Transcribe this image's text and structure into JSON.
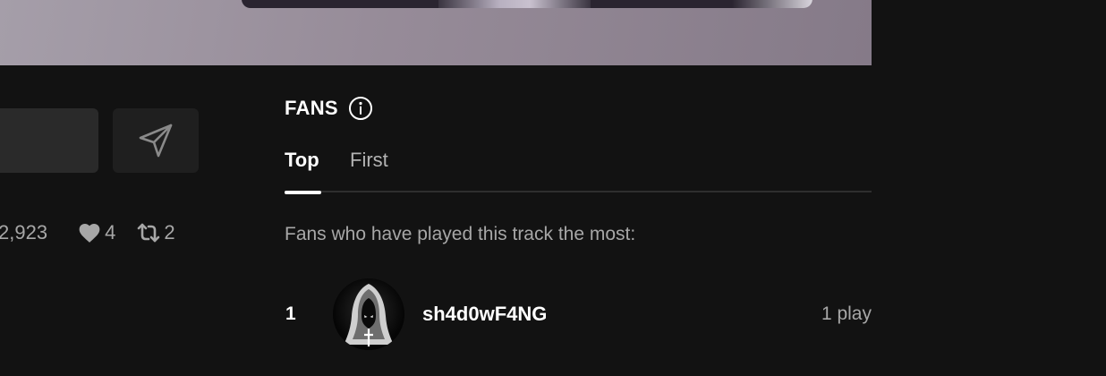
{
  "stats": {
    "plays": "2,923",
    "likes": "4",
    "reposts": "2"
  },
  "fans": {
    "title": "FANS",
    "tabs": [
      {
        "label": "Top",
        "active": true
      },
      {
        "label": "First",
        "active": false
      }
    ],
    "description": "Fans who have played this track the most:",
    "list": [
      {
        "rank": "1",
        "name": "sh4d0wF4NG",
        "plays": "1 play"
      }
    ]
  },
  "icons": {
    "send": "paper-plane-icon",
    "info": "info-circle-icon",
    "like": "heart-icon",
    "repost": "repost-icon"
  },
  "colors": {
    "background": "#121212",
    "text_primary": "#ffffff",
    "text_secondary": "#a7a7a7"
  }
}
